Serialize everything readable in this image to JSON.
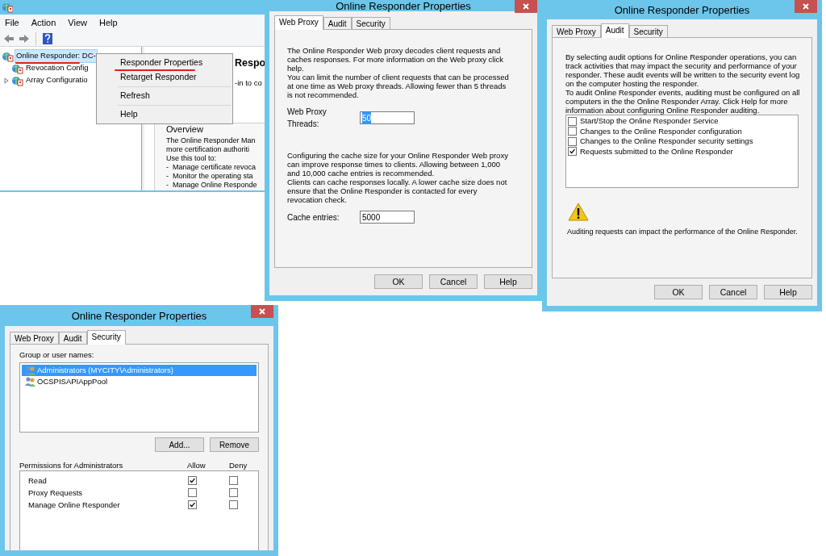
{
  "console": {
    "menu": [
      "File",
      "Action",
      "View",
      "Help"
    ],
    "tree": [
      {
        "label": "Online Responder: DC-",
        "selected": true,
        "children": [
          {
            "label": "Revocation Config",
            "selected": false,
            "expandable": false
          },
          {
            "label": "Array Configuratio",
            "selected": false,
            "expandable": true
          }
        ]
      }
    ],
    "details": {
      "heading": "Respo",
      "intro": "-in to co",
      "section_title": "Overview",
      "lines": [
        "The Online Responder Man",
        "more certification authoriti",
        "Use this tool to:",
        "-  Manage certificate revoca",
        "-  Monitor the operating sta",
        "-  Manage Online Responde"
      ]
    },
    "context_menu": {
      "groups": [
        [
          "Responder Properties",
          "Retarget Responder"
        ],
        [
          "Refresh"
        ],
        [
          "Help"
        ]
      ]
    }
  },
  "web_proxy_dialog": {
    "title": "Online Responder Properties",
    "tabs": [
      {
        "label": "Web Proxy",
        "selected": true
      },
      {
        "label": "Audit",
        "selected": false
      },
      {
        "label": "Security",
        "selected": false
      }
    ],
    "paragraphs_1": [
      "The Online Responder Web proxy decodes client requests and caches responses. For more information on the Web proxy click help.",
      "You can limit the number of client requests that can be processed at one time as Web proxy threads. Allowing fewer than 5 threads is not recommended."
    ],
    "threads_field": {
      "label": "Web Proxy Threads:",
      "value": "50",
      "value_selected": true
    },
    "paragraphs_2": [
      "Configuring the cache size for your Online Responder Web proxy can improve response times to clients. Allowing between 1,000 and 10,000 cache entries is recommended.",
      "Clients can cache responses locally. A lower cache size does not ensure that the Online Responder is contacted for every revocation check."
    ],
    "cache_field": {
      "label": "Cache entries:",
      "value": "5000",
      "value_selected": false
    },
    "buttons": [
      "OK",
      "Cancel",
      "Help"
    ]
  },
  "audit_dialog": {
    "title": "Online Responder Properties",
    "tabs": [
      {
        "label": "Web Proxy",
        "selected": false
      },
      {
        "label": "Audit",
        "selected": true
      },
      {
        "label": "Security",
        "selected": false
      }
    ],
    "paragraphs": [
      "By selecting audit options for Online Responder operations, you can track activities that may impact the security and performance of your responder. These audit events will be written to the security event log on the computer hosting the responder.",
      "To audit Online Responder events, auditing must be configured on all computers in the the Online Responder Array. Click Help for more information about configuring Online Responder auditing."
    ],
    "options": [
      {
        "label": "Start/Stop the Online Responder Service",
        "checked": false
      },
      {
        "label": "Changes to the Online Responder configuration",
        "checked": false
      },
      {
        "label": "Changes to the Online Responder security settings",
        "checked": false
      },
      {
        "label": "Requests submitted to the Online Responder",
        "checked": true
      }
    ],
    "warning": "Auditing requests can impact the performance of the Online Responder.",
    "buttons": [
      "OK",
      "Cancel",
      "Help"
    ]
  },
  "security_dialog": {
    "title": "Online Responder Properties",
    "tabs": [
      {
        "label": "Web Proxy",
        "selected": false
      },
      {
        "label": "Audit",
        "selected": false
      },
      {
        "label": "Security",
        "selected": true
      }
    ],
    "users_label": "Group or user names:",
    "users": [
      {
        "name": "Administrators (MYCITY\\Administrators)",
        "selected": true
      },
      {
        "name": "OCSPISAPIAppPool",
        "selected": false
      }
    ],
    "user_buttons": [
      "Add...",
      "Remove"
    ],
    "permissions_label": "Permissions for Administrators",
    "allow_header": "Allow",
    "deny_header": "Deny",
    "permissions": [
      {
        "name": "Read",
        "allow": true,
        "deny": false
      },
      {
        "name": "Proxy Requests",
        "allow": false,
        "deny": false
      },
      {
        "name": "Manage Online Responder",
        "allow": true,
        "deny": false
      }
    ]
  }
}
